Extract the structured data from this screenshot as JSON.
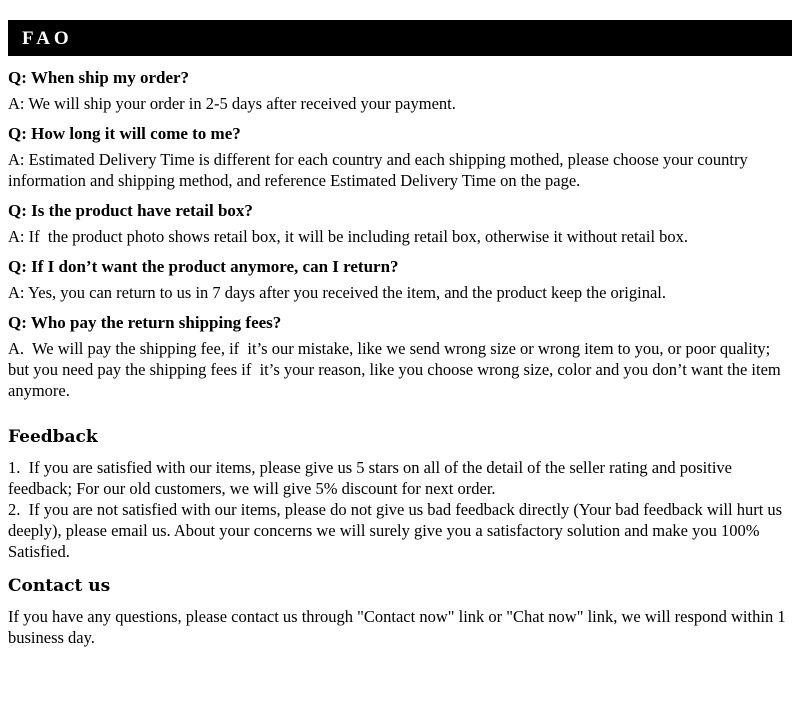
{
  "header": {
    "title": "FAO",
    "background_color": "#000000",
    "text_color": "#ffffff"
  },
  "faq": [
    {
      "question": "Q: When ship my order?",
      "answer": "A: We will ship your order in 2-5 days after received your payment."
    },
    {
      "question": "Q: How long it will come to me?",
      "answer": "A: Estimated Delivery Time is different for each country and each shipping mothed, please choose your country information and shipping method, and reference Estimated Delivery Time on the page."
    },
    {
      "question": "Q: Is the product have retail box?",
      "answer": "A: If  the product photo shows retail box, it will be including retail box, otherwise it without retail box."
    },
    {
      "question": "Q: If I don’t want the product anymore, can I return?",
      "answer": "A: Yes, you can return to us in 7 days after you received the item, and the product keep the original."
    },
    {
      "question": "Q: Who pay the return shipping fees?",
      "answer": "A.  We will pay the shipping fee, if  it’s our mistake, like we send wrong size or wrong item to you, or poor quality; but you need pay the shipping fees if  it’s your reason, like you choose wrong size, color and you don’t want the item anymore."
    }
  ],
  "feedback": {
    "heading": "Feedback",
    "body": "1.  If you are satisfied with our items, please give us 5 stars on all of the detail of the seller rating and positive feedback; For our old customers, we will give 5% discount for next order.\n2.  If you are not satisfied with our items, please do not give us bad feedback directly (Your bad feedback will hurt us deeply), please email us. About your concerns we will surely give you a satisfactory solution and make you 100% Satisfied."
  },
  "contact": {
    "heading": "Contact us",
    "body": "If you have any questions, please contact us through \"Contact now\" link or \"Chat now\" link, we will respond within 1 business day."
  }
}
